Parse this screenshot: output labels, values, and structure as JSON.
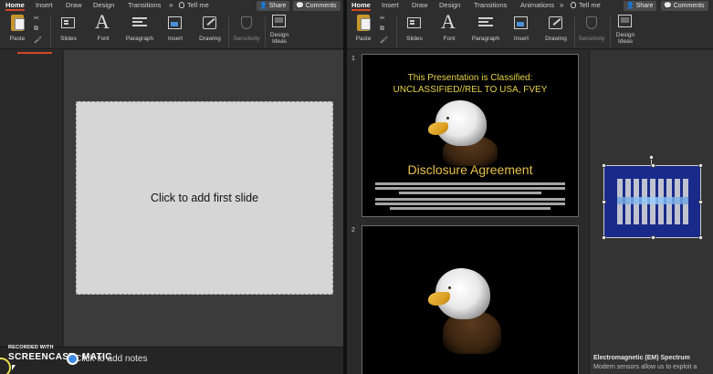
{
  "left_window": {
    "tabs": [
      "Home",
      "Insert",
      "Draw",
      "Design",
      "Transitions"
    ],
    "more_tabs": "»",
    "tell_me": "Tell me",
    "share": "Share",
    "comments": "Comments",
    "ribbon": {
      "paste": "Paste",
      "slides": "Slides",
      "font": "Font",
      "paragraph": "Paragraph",
      "insert": "Insert",
      "drawing": "Drawing",
      "sensitivity": "Sensitivity",
      "design_ideas": [
        "Design",
        "Ideas"
      ]
    },
    "slide_placeholder": "Click to add first slide",
    "notes_placeholder": "Click to add notes"
  },
  "right_window": {
    "tabs": [
      "Home",
      "Insert",
      "Draw",
      "Design",
      "Transitions",
      "Animations"
    ],
    "more_tabs": "»",
    "tell_me": "Tell me",
    "share": "Share",
    "comments": "Comments",
    "ribbon": {
      "paste": "Paste",
      "slides": "Slides",
      "font": "Font",
      "paragraph": "Paragraph",
      "insert": "Insert",
      "drawing": "Drawing",
      "sensitivity": "Sensitivity",
      "design_ideas": [
        "Design",
        "Ideas"
      ]
    },
    "slides": [
      {
        "number": "1",
        "title_line1": "This Presentation is Classified:",
        "title_line2": "UNCLASSIFIED//REL TO USA, FVEY",
        "heading": "Disclosure Agreement"
      },
      {
        "number": "2"
      }
    ],
    "side_panel": {
      "title": "Electromagnetic (EM) Spectrum",
      "subtitle": "Modern sensors allow us to exploit a"
    }
  },
  "watermark": {
    "recorded_with": "RECORDED WITH",
    "brand_left": "SCREENCAST",
    "brand_right": "MATIC"
  },
  "colors": {
    "accent_tab": "#d24726",
    "slide_title": "#e8d24a",
    "em_slide_bg": "#1a2a8a"
  }
}
